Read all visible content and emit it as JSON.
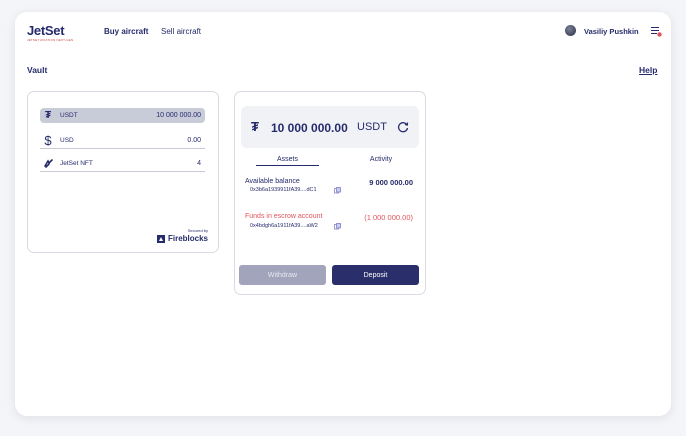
{
  "header": {
    "logo": "JetSet",
    "logo_sub": "JETSET AVIATION NEXT-GEN",
    "nav": [
      {
        "label": "Buy aircraft",
        "active": true
      },
      {
        "label": "Sell aircraft",
        "active": false
      }
    ],
    "user_name": "Vasiliy Pushkin"
  },
  "page": {
    "title": "Vault",
    "help": "Help"
  },
  "wallets": [
    {
      "icon": "tether-icon",
      "name": "USDT",
      "amount": "10 000 000.00",
      "selected": true
    },
    {
      "icon": "dollar-icon",
      "name": "USD",
      "amount": "0.00",
      "selected": false
    },
    {
      "icon": "nft-icon",
      "name": "JetSet NFT",
      "amount": "4",
      "selected": false
    }
  ],
  "security": {
    "secured_by": "Secured by",
    "provider": "Fireblocks"
  },
  "detail": {
    "balance": "10 000 000.00",
    "ticker": "USDT",
    "tabs": [
      "Assets",
      "Activity"
    ],
    "available": {
      "label": "Available balance",
      "address": "0x3b6a1939911fA39....dC1",
      "amount": "9 000 000.00"
    },
    "escrow": {
      "label": "Funds in escrow account",
      "address": "0x4bdgh6a1911fA39....aW2",
      "amount": "(1 000 000.00)"
    },
    "withdraw_label": "Withdraw",
    "deposit_label": "Deposit"
  },
  "colors": {
    "brand": "#262b6b",
    "accent_red": "#e0555a",
    "selected_row": "#c8cbd8",
    "disabled_button": "#a1a4bb",
    "primary_button": "#2a2f6b"
  }
}
